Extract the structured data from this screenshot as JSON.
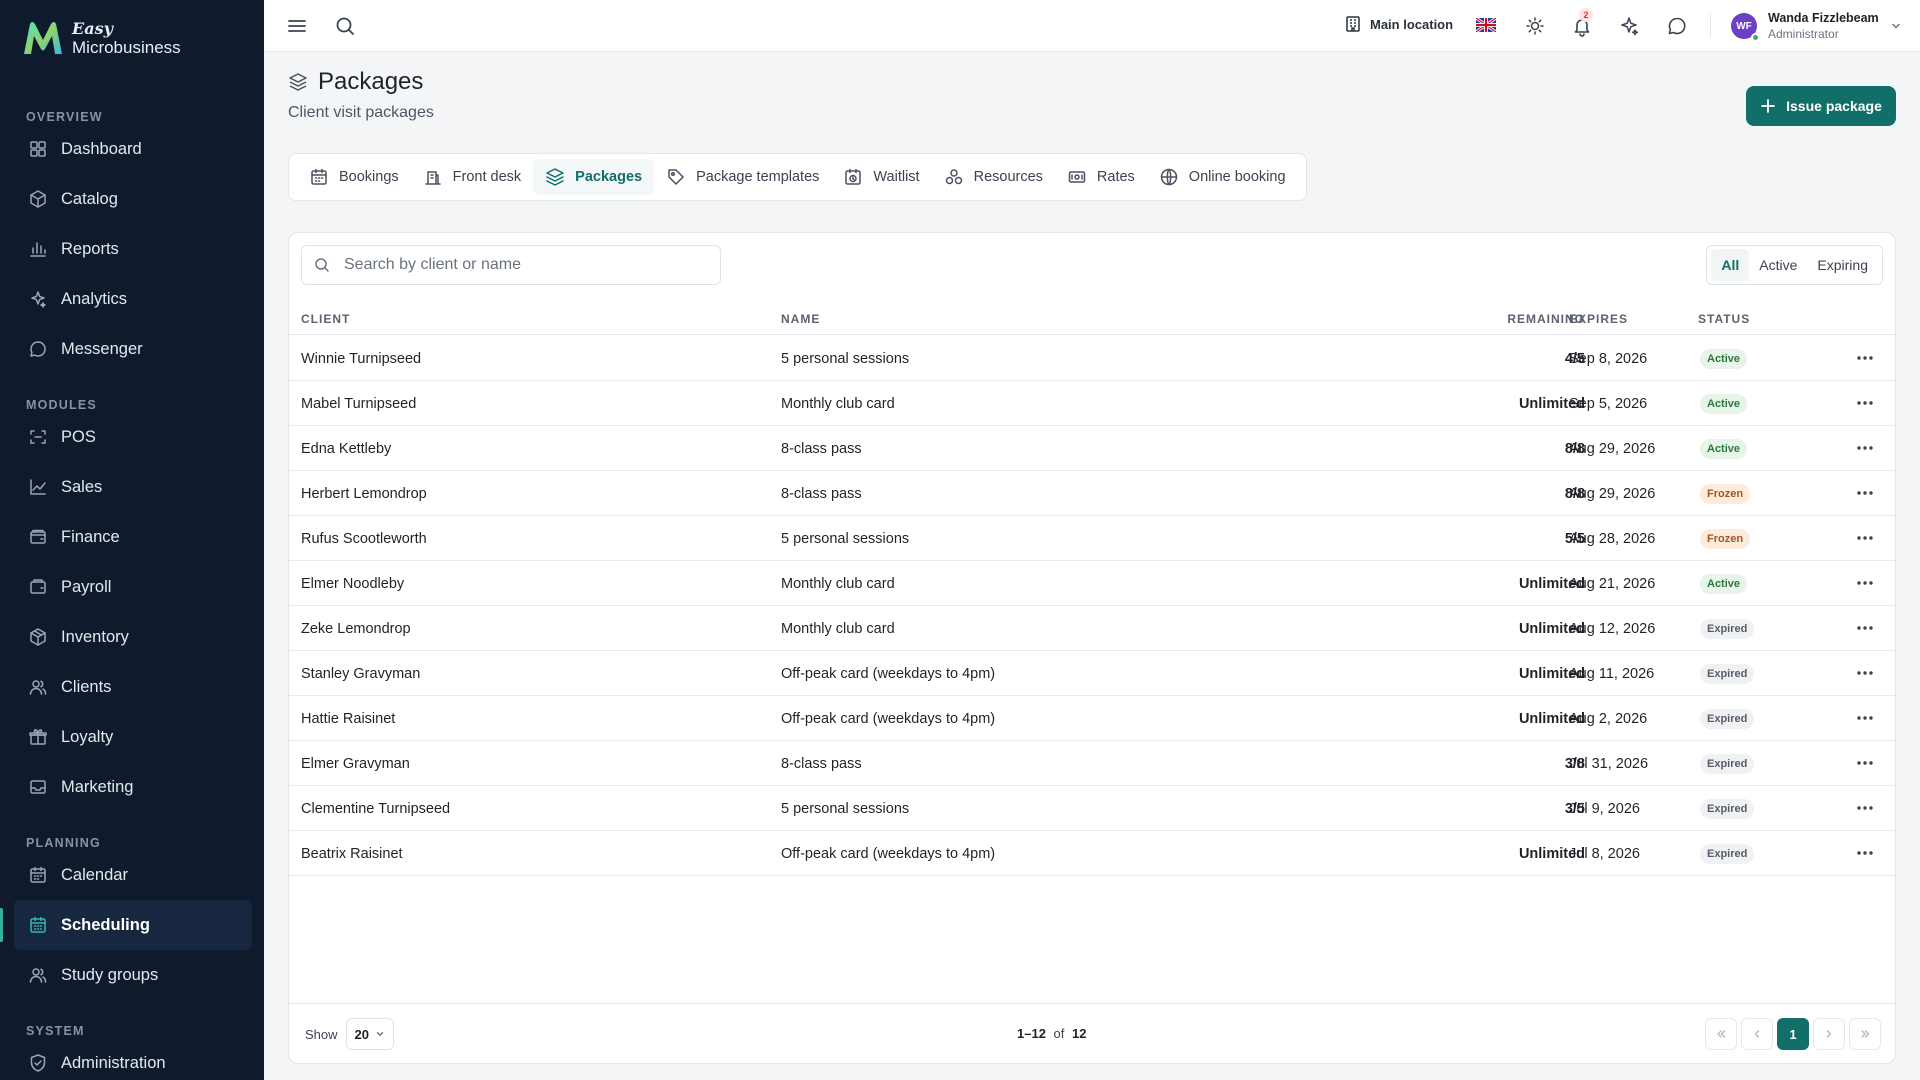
{
  "brand": {
    "line1": "Easy",
    "line2": "Microbusiness"
  },
  "sidebar": {
    "sections": [
      {
        "label": "OVERVIEW",
        "items": [
          {
            "label": "Dashboard",
            "icon": "dashboard-icon"
          },
          {
            "label": "Catalog",
            "icon": "catalog-icon"
          },
          {
            "label": "Reports",
            "icon": "reports-icon"
          },
          {
            "label": "Analytics",
            "icon": "analytics-icon"
          },
          {
            "label": "Messenger",
            "icon": "messenger-icon"
          }
        ]
      },
      {
        "label": "MODULES",
        "items": [
          {
            "label": "POS",
            "icon": "pos-icon"
          },
          {
            "label": "Sales",
            "icon": "sales-icon"
          },
          {
            "label": "Finance",
            "icon": "finance-icon"
          },
          {
            "label": "Payroll",
            "icon": "payroll-icon"
          },
          {
            "label": "Inventory",
            "icon": "inventory-icon"
          },
          {
            "label": "Clients",
            "icon": "clients-icon"
          },
          {
            "label": "Loyalty",
            "icon": "loyalty-icon"
          },
          {
            "label": "Marketing",
            "icon": "marketing-icon"
          }
        ]
      },
      {
        "label": "PLANNING",
        "items": [
          {
            "label": "Calendar",
            "icon": "calendar-icon"
          },
          {
            "label": "Scheduling",
            "icon": "scheduling-icon",
            "active": true
          },
          {
            "label": "Study groups",
            "icon": "study-groups-icon"
          }
        ]
      },
      {
        "label": "SYSTEM",
        "items": [
          {
            "label": "Administration",
            "icon": "administration-icon"
          }
        ]
      }
    ]
  },
  "topbar": {
    "location": "Main location",
    "notifications_count": "2",
    "user": {
      "initials": "WF",
      "name": "Wanda Fizzlebeam",
      "role": "Administrator"
    }
  },
  "page": {
    "title": "Packages",
    "subtitle": "Client visit packages",
    "issue_button": "Issue package"
  },
  "tabs": [
    {
      "label": "Bookings",
      "icon": "calendar-icon"
    },
    {
      "label": "Front desk",
      "icon": "front-desk-icon"
    },
    {
      "label": "Packages",
      "icon": "layers-icon",
      "active": true
    },
    {
      "label": "Package templates",
      "icon": "tag-icon"
    },
    {
      "label": "Waitlist",
      "icon": "waitlist-icon"
    },
    {
      "label": "Resources",
      "icon": "resources-icon"
    },
    {
      "label": "Rates",
      "icon": "rates-icon"
    },
    {
      "label": "Online booking",
      "icon": "globe-icon"
    }
  ],
  "search": {
    "placeholder": "Search by client or name"
  },
  "filters": [
    {
      "label": "All",
      "active": true
    },
    {
      "label": "Active"
    },
    {
      "label": "Expiring"
    }
  ],
  "table": {
    "columns": {
      "client": "CLIENT",
      "name": "NAME",
      "remaining": "REMAINING",
      "expires": "EXPIRES",
      "status": "STATUS"
    },
    "rows": [
      {
        "client": "Winnie Turnipseed",
        "name": "5 personal sessions",
        "remaining": "4/5",
        "expires": "Sep 8, 2026",
        "status": "Active",
        "kind": "active"
      },
      {
        "client": "Mabel Turnipseed",
        "name": "Monthly club card",
        "remaining": "Unlimited",
        "expires": "Sep 5, 2026",
        "status": "Active",
        "kind": "active"
      },
      {
        "client": "Edna Kettleby",
        "name": "8-class pass",
        "remaining": "8/8",
        "expires": "Aug 29, 2026",
        "status": "Active",
        "kind": "active"
      },
      {
        "client": "Herbert Lemondrop",
        "name": "8-class pass",
        "remaining": "8/8",
        "expires": "Aug 29, 2026",
        "status": "Frozen",
        "kind": "frozen"
      },
      {
        "client": "Rufus Scootleworth",
        "name": "5 personal sessions",
        "remaining": "5/5",
        "expires": "Aug 28, 2026",
        "status": "Frozen",
        "kind": "frozen"
      },
      {
        "client": "Elmer Noodleby",
        "name": "Monthly club card",
        "remaining": "Unlimited",
        "expires": "Aug 21, 2026",
        "status": "Active",
        "kind": "active"
      },
      {
        "client": "Zeke Lemondrop",
        "name": "Monthly club card",
        "remaining": "Unlimited",
        "expires": "Aug 12, 2026",
        "status": "Expired",
        "kind": "expired"
      },
      {
        "client": "Stanley Gravyman",
        "name": "Off-peak card (weekdays to 4pm)",
        "remaining": "Unlimited",
        "expires": "Aug 11, 2026",
        "status": "Expired",
        "kind": "expired"
      },
      {
        "client": "Hattie Raisinet",
        "name": "Off-peak card (weekdays to 4pm)",
        "remaining": "Unlimited",
        "expires": "Aug 2, 2026",
        "status": "Expired",
        "kind": "expired"
      },
      {
        "client": "Elmer Gravyman",
        "name": "8-class pass",
        "remaining": "3/8",
        "expires": "Jul 31, 2026",
        "status": "Expired",
        "kind": "expired"
      },
      {
        "client": "Clementine Turnipseed",
        "name": "5 personal sessions",
        "remaining": "3/5",
        "expires": "Jul 9, 2026",
        "status": "Expired",
        "kind": "expired"
      },
      {
        "client": "Beatrix Raisinet",
        "name": "Off-peak card (weekdays to 4pm)",
        "remaining": "Unlimited",
        "expires": "Jul 8, 2026",
        "status": "Expired",
        "kind": "expired"
      }
    ]
  },
  "footer": {
    "show_label": "Show",
    "page_size": "20",
    "range": "1–12",
    "of": "of",
    "total": "12",
    "current_page": "1"
  },
  "colors": {
    "accent": "#126e69",
    "sidebar_bg": "#0f1b2d"
  }
}
